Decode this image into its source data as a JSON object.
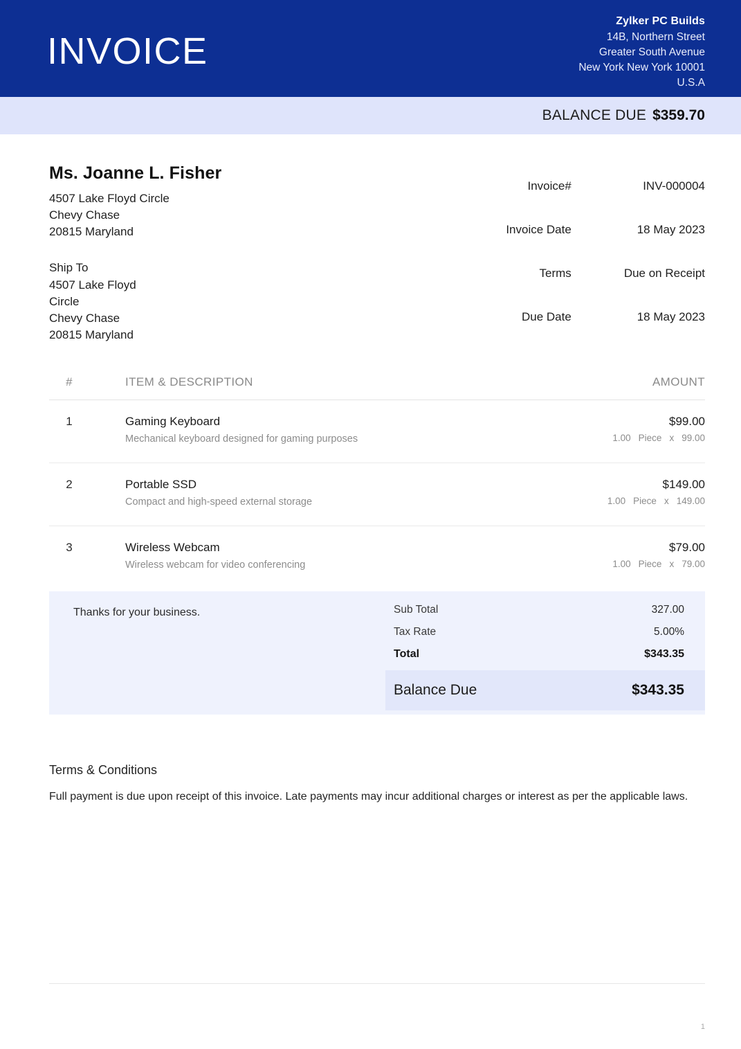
{
  "header": {
    "title": "INVOICE",
    "brand_color": "#0d2f93",
    "company": {
      "name": "Zylker PC Builds",
      "address_lines": [
        "14B, Northern Street",
        "Greater South Avenue",
        "New York New York 10001",
        "U.S.A"
      ]
    }
  },
  "balance_band": {
    "label": "BALANCE DUE",
    "amount": "$359.70",
    "background": "#dfe4fb"
  },
  "bill_to": {
    "customer_name": "Ms. Joanne L. Fisher",
    "address_lines": [
      "4507 Lake Floyd Circle",
      "Chevy Chase",
      "20815 Maryland"
    ]
  },
  "ship_to": {
    "label": "Ship To",
    "address_lines": [
      "4507 Lake Floyd",
      "Circle",
      "Chevy Chase",
      "20815 Maryland"
    ]
  },
  "meta": [
    {
      "label": "Invoice#",
      "value": "INV-000004"
    },
    {
      "label": "Invoice Date",
      "value": "18 May 2023"
    },
    {
      "label": "Terms",
      "value": "Due on Receipt"
    },
    {
      "label": "Due Date",
      "value": "18 May 2023"
    }
  ],
  "items_table": {
    "columns": {
      "number": "#",
      "item": "ITEM & DESCRIPTION",
      "amount": "AMOUNT"
    },
    "rows": [
      {
        "number": "1",
        "name": "Gaming Keyboard",
        "description": "Mechanical keyboard designed for gaming purposes",
        "amount": "$99.00",
        "quantity": "1.00",
        "unit": "Piece",
        "operator": "x",
        "rate": "99.00"
      },
      {
        "number": "2",
        "name": "Portable SSD",
        "description": "Compact and high-speed external storage",
        "amount": "$149.00",
        "quantity": "1.00",
        "unit": "Piece",
        "operator": "x",
        "rate": "149.00"
      },
      {
        "number": "3",
        "name": "Wireless Webcam",
        "description": "Wireless webcam for video conferencing",
        "amount": "$79.00",
        "quantity": "1.00",
        "unit": "Piece",
        "operator": "x",
        "rate": "79.00"
      }
    ]
  },
  "totals": {
    "thanks_note": "Thanks for your business.",
    "sub_total_label": "Sub Total",
    "sub_total_value": "327.00",
    "tax_rate_label": "Tax Rate",
    "tax_rate_value": "5.00%",
    "total_label": "Total",
    "total_value": "$343.35",
    "balance_due_label": "Balance Due",
    "balance_due_value": "$343.35",
    "background": "#eff2fd",
    "balance_highlight": "#e2e7fa"
  },
  "terms": {
    "title": "Terms & Conditions",
    "text": "Full payment is due upon receipt of this invoice. Late payments may incur additional charges or interest as per the applicable laws."
  },
  "footer": {
    "page_number": "1"
  }
}
